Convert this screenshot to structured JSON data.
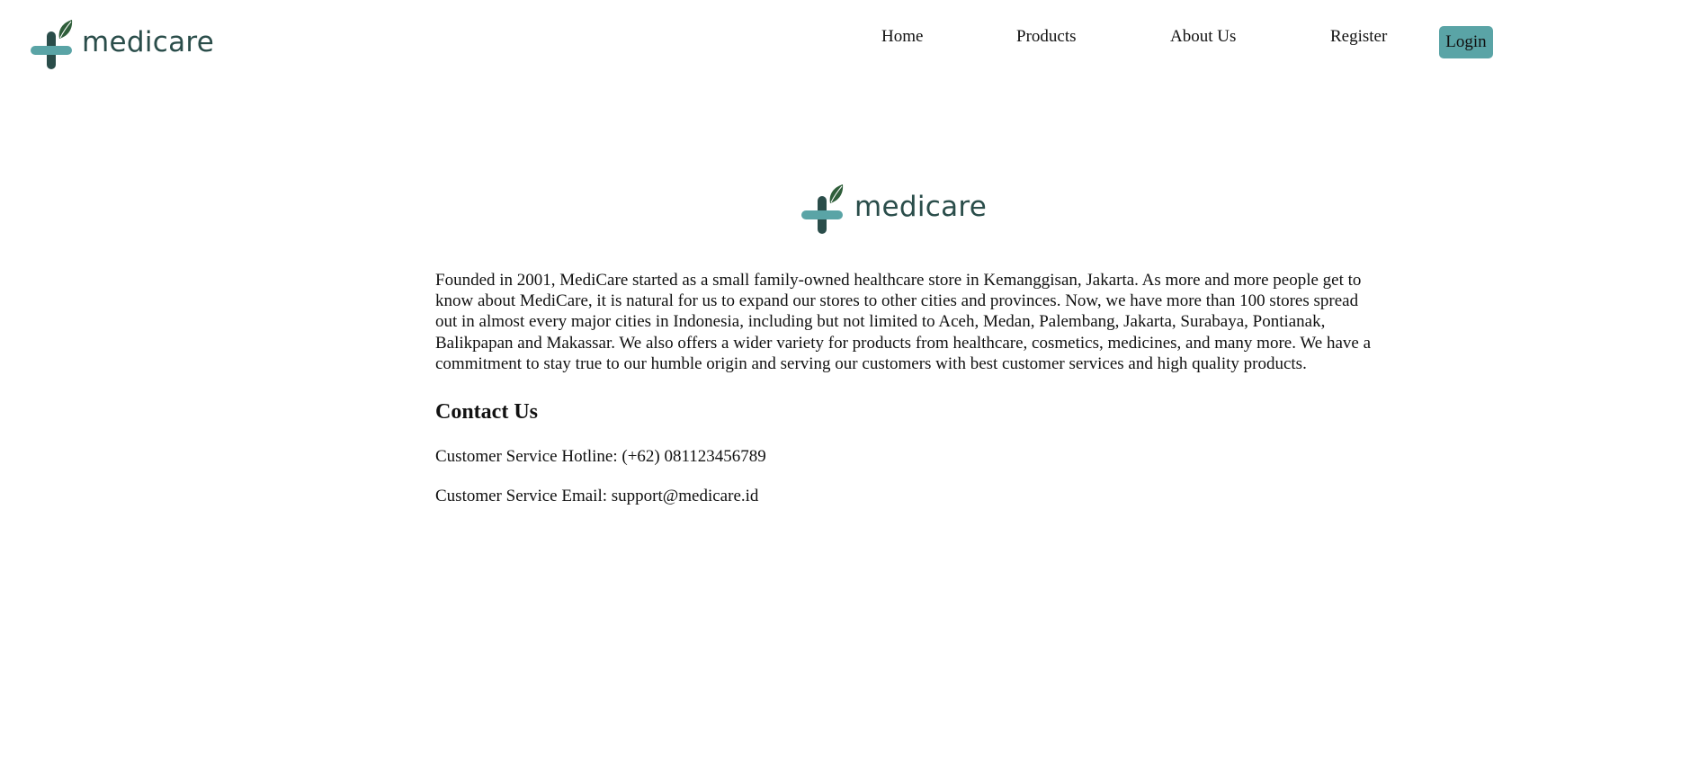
{
  "header": {
    "logo_text": "medicare",
    "nav": {
      "home": "Home",
      "products": "Products",
      "about": "About Us",
      "register": "Register",
      "login": "Login"
    }
  },
  "about": {
    "logo_text": "medicare",
    "description": "Founded in 2001, MediCare started as a small family-owned healthcare store in Kemanggisan, Jakarta. As more and more people get to know about MediCare, it is natural for us to expand our stores to other cities and provinces. Now, we have more than 100 stores spread out in almost every major cities in Indonesia, including but not limited to Aceh, Medan, Palembang, Jakarta, Surabaya, Pontianak, Balikpapan and Makassar. We also offers a wider variety for products from healthcare, cosmetics, medicines, and many more. We have a commitment to stay true to our humble origin and serving our customers with best customer services and high quality products.",
    "contact_title": "Contact Us",
    "hotline": "Customer Service Hotline: (+62) 081123456789",
    "email": "Customer Service Email: support@medicare.id"
  },
  "colors": {
    "brand_dark": "#2a4d4a",
    "brand_teal": "#5aa4a6",
    "leaf_green": "#2f5e3a"
  },
  "icons": {
    "logo_mark": "medical-cross-leaf-icon"
  }
}
